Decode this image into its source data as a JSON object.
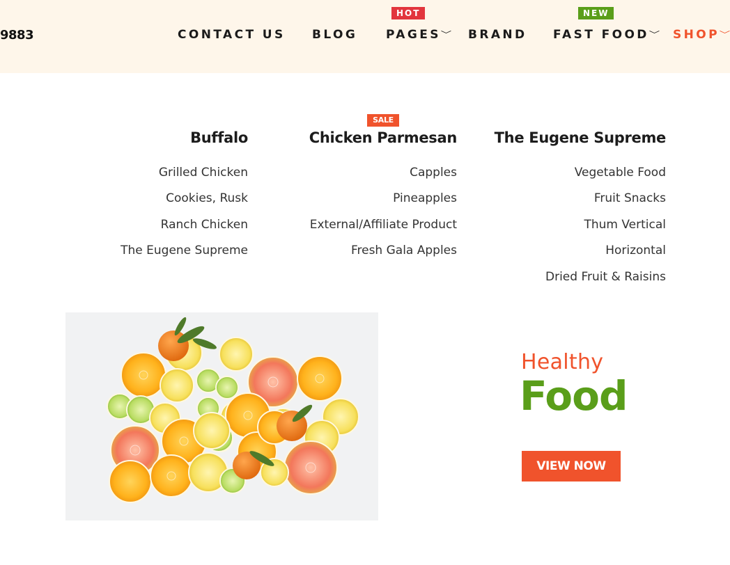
{
  "header": {
    "phone_fragment": "9883",
    "nav": [
      {
        "label": "CONTACT US",
        "has_dropdown": false
      },
      {
        "label": "BLOG",
        "has_dropdown": false
      },
      {
        "label": "PAGES",
        "has_dropdown": true,
        "badge": "HOT"
      },
      {
        "label": "BRAND",
        "has_dropdown": false
      },
      {
        "label": "FAST FOOD",
        "has_dropdown": true,
        "badge": "NEW"
      },
      {
        "label": "SHOP",
        "has_dropdown": true,
        "active": true
      }
    ],
    "chevron_glyph": "v"
  },
  "mega_menu": {
    "columns": [
      {
        "title": "Buffalo",
        "links": [
          "Grilled Chicken",
          "Cookies, Rusk",
          "Ranch Chicken",
          "The Eugene Supreme"
        ]
      },
      {
        "title": "Chicken Parmesan",
        "badge": "SALE",
        "links": [
          "Capples",
          "Pineapples",
          "External/Affiliate Product",
          "Fresh Gala Apples"
        ]
      },
      {
        "title": "The Eugene Supreme",
        "links": [
          "Vegetable Food",
          "Fruit Snacks",
          "Thum Vertical",
          "Horizontal",
          "Dried Fruit & Raisins"
        ]
      }
    ]
  },
  "promo": {
    "subtitle": "Healthy",
    "title": "Food",
    "button_label": "VIEW NOW"
  },
  "colors": {
    "accent": "#f0532c",
    "green": "#5a9e1a",
    "hot_badge": "#e2353d",
    "topbar_bg": "#fef6ea"
  }
}
